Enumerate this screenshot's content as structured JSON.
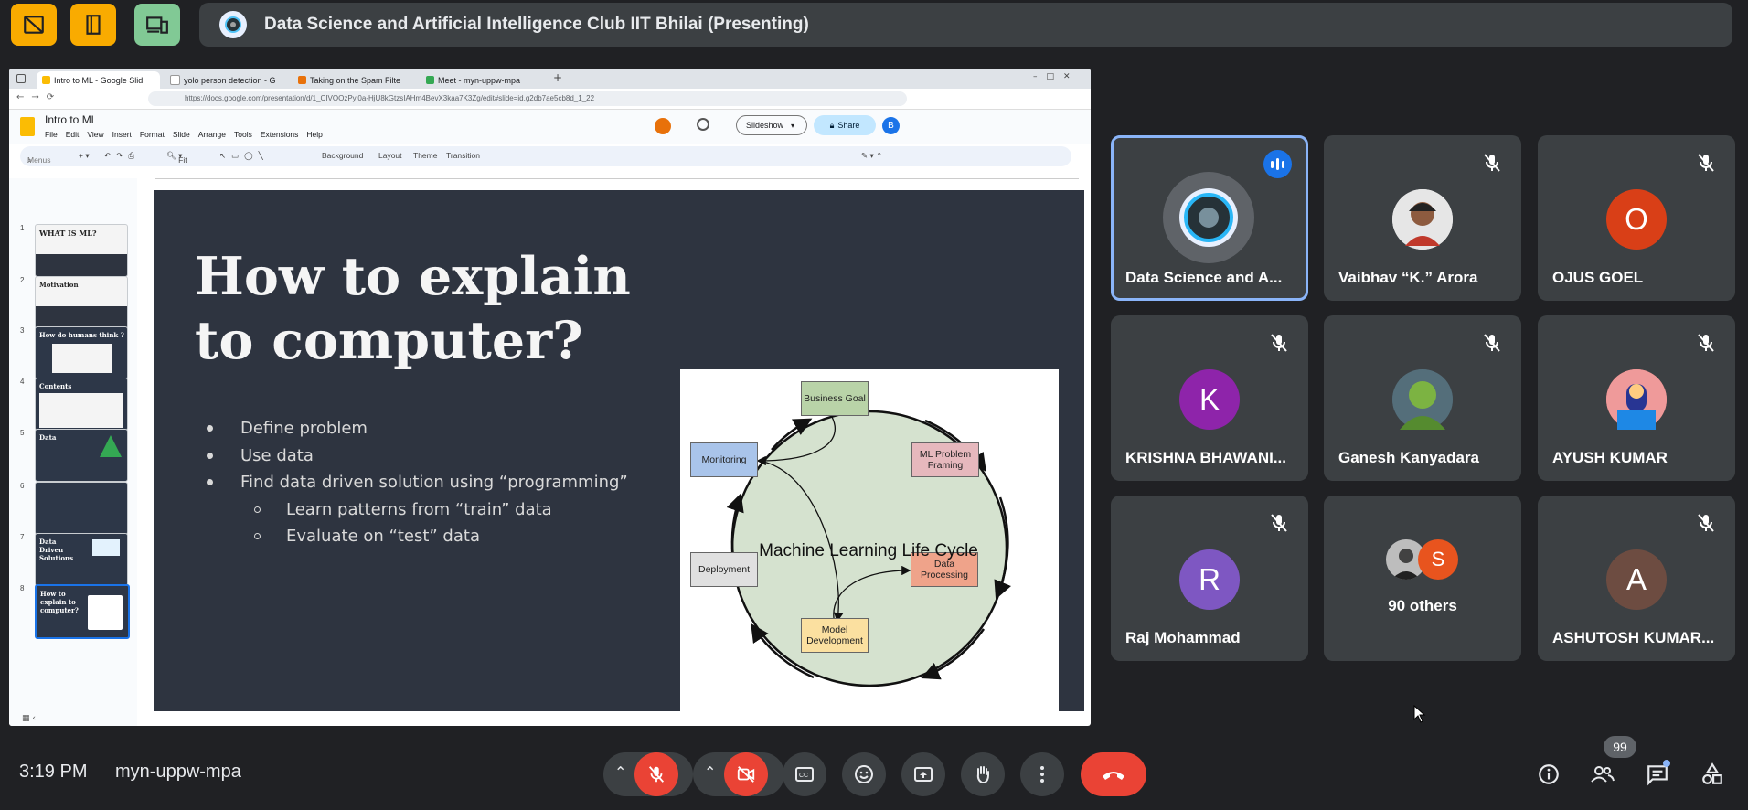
{
  "top_bar": {
    "presenting_title": "Data Science and Artificial Intelligence Club IIT Bhilai (Presenting)",
    "buttons": [
      {
        "icon": "no-video-layout-icon",
        "color": "#f9ab00"
      },
      {
        "icon": "door-icon",
        "color": "#f9ab00"
      },
      {
        "icon": "screen-share-device-icon",
        "color": "#81c995"
      }
    ]
  },
  "browser": {
    "tabs": [
      {
        "label": "Intro to ML - Google Slid",
        "active": true,
        "favicon_color": "#fbbc04"
      },
      {
        "label": "yolo person detection - G",
        "active": false,
        "favicon_color": "#ffffff"
      },
      {
        "label": "Taking on the Spam Filte",
        "active": false,
        "favicon_color": "#e8710a"
      },
      {
        "label": "Meet - myn-uppw-mpa",
        "active": false,
        "favicon_color": "#34a853"
      }
    ],
    "url": "https://docs.google.com/presentation/d/1_CIVOOzPyl0a-HjU8kGtzsIAHm4BevX3kaa7K3Zg/edit#slide=id.g2db7ae5cb8d_1_22"
  },
  "slides_app": {
    "title": "Intro to ML",
    "menu": [
      "File",
      "Edit",
      "View",
      "Insert",
      "Format",
      "Slide",
      "Arrange",
      "Tools",
      "Extensions",
      "Help"
    ],
    "toolbar": {
      "search_placeholder": "Menus",
      "zoom": "Fit",
      "background": "Background",
      "layout": "Layout",
      "theme": "Theme",
      "transition": "Transition"
    },
    "slideshow_label": "Slideshow",
    "share_label": "Share",
    "user_initial": "B",
    "thumbnails": [
      {
        "num": "1",
        "title": "WHAT IS ML?"
      },
      {
        "num": "2",
        "title": "Motivation"
      },
      {
        "num": "3",
        "title": "How do humans think ?"
      },
      {
        "num": "4",
        "title": "Contents"
      },
      {
        "num": "5",
        "title": "Data"
      },
      {
        "num": "6",
        "title": ""
      },
      {
        "num": "7",
        "title": "Data Driven Solutions"
      },
      {
        "num": "8",
        "title": "How to explain to computer?"
      }
    ],
    "current_slide": {
      "title_line1": "How to explain",
      "title_line2": "to computer?",
      "bullets": [
        "Define problem",
        "Use data",
        "Find data driven solution using “programming”"
      ],
      "sub_bullets": [
        "Learn patterns from “train” data",
        "Evaluate on “test” data"
      ],
      "diagram": {
        "center_label": "Machine Learning Life Cycle",
        "nodes": {
          "business_goal": "Business Goal",
          "ml_problem_line1": "ML Problem",
          "ml_problem_line2": "Framing",
          "data_processing": "Data Processing",
          "model_dev_line1": "Model",
          "model_dev_line2": "Development",
          "deployment": "Deployment",
          "monitoring": "Monitoring"
        }
      }
    }
  },
  "participants": [
    {
      "name": "Data Science and A...",
      "initial": "",
      "avatar_color": "#e8f0fe",
      "speaking": true
    },
    {
      "name": "Vaibhav “K.” Arora",
      "initial": "",
      "avatar_color": "#e6e6e6",
      "speaking": false
    },
    {
      "name": "OJUS GOEL",
      "initial": "O",
      "avatar_color": "#d93f17",
      "speaking": false
    },
    {
      "name": "KRISHNA BHAWANI...",
      "initial": "K",
      "avatar_color": "#8e24aa",
      "speaking": false
    },
    {
      "name": "Ganesh Kanyadara",
      "initial": "",
      "avatar_color": "#6d8b3a",
      "speaking": false
    },
    {
      "name": "AYUSH KUMAR",
      "initial": "",
      "avatar_color": "#e57373",
      "speaking": false
    },
    {
      "name": "Raj Mohammad",
      "initial": "R",
      "avatar_color": "#7e57c2",
      "speaking": false
    },
    {
      "name": "90 others",
      "initial": "S",
      "avatar_color": "#e8541e",
      "speaking": false
    },
    {
      "name": "ASHUTOSH KUMAR...",
      "initial": "A",
      "avatar_color": "#6d4c41",
      "speaking": false
    }
  ],
  "bottom_bar": {
    "time": "3:19 PM",
    "meeting_code": "myn-uppw-mpa",
    "participant_count": "99"
  }
}
